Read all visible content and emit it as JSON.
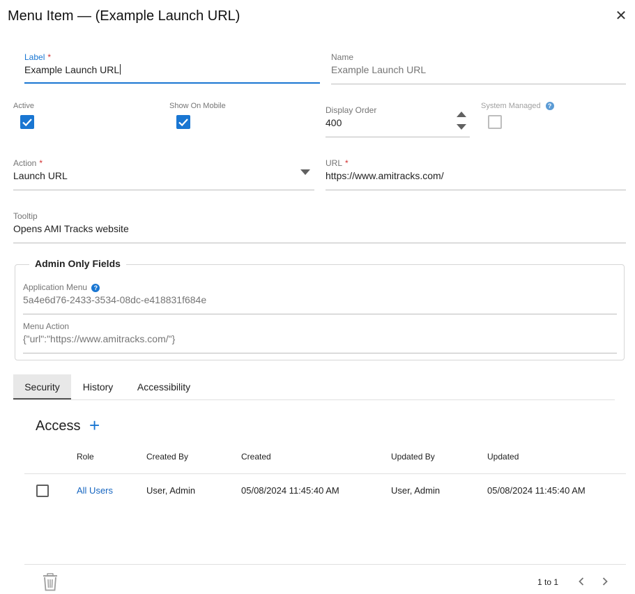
{
  "dialog": {
    "title": "Menu Item — (Example Launch URL)",
    "close_glyph": "✕"
  },
  "fields": {
    "label": {
      "label": "Label",
      "required": "*",
      "value": "Example Launch URL"
    },
    "name": {
      "label": "Name",
      "value": "Example Launch URL"
    },
    "active": {
      "label": "Active",
      "checked": true
    },
    "show_on_mobile": {
      "label": "Show On Mobile",
      "checked": true
    },
    "display_order": {
      "label": "Display Order",
      "value": "400"
    },
    "system_managed": {
      "label": "System Managed",
      "checked": false,
      "help_glyph": "?"
    },
    "action": {
      "label": "Action",
      "required": "*",
      "value": "Launch URL"
    },
    "url": {
      "label": "URL",
      "required": "*",
      "value": "https://www.amitracks.com/"
    },
    "tooltip": {
      "label": "Tooltip",
      "value": "Opens AMI Tracks website"
    }
  },
  "admin_fields": {
    "legend": "Admin Only Fields",
    "application_menu": {
      "label": "Application Menu",
      "value": "5a4e6d76-2433-3534-08dc-e418831f684e",
      "help_glyph": "?"
    },
    "menu_action": {
      "label": "Menu Action",
      "value": "{\"url\":\"https://www.amitracks.com/\"}"
    }
  },
  "tabs": [
    {
      "label": "Security",
      "active": true
    },
    {
      "label": "History",
      "active": false
    },
    {
      "label": "Accessibility",
      "active": false
    }
  ],
  "access": {
    "title": "Access",
    "add_glyph": "+",
    "columns": [
      "Role",
      "Created By",
      "Created",
      "Updated By",
      "Updated"
    ],
    "rows": [
      {
        "role": "All Users",
        "created_by": "User, Admin",
        "created": "05/08/2024 11:45:40 AM",
        "updated_by": "User, Admin",
        "updated": "05/08/2024 11:45:40 AM"
      }
    ],
    "pager": {
      "text": "1 to 1",
      "prev_glyph": "‹",
      "next_glyph": "›"
    }
  },
  "colors": {
    "accent": "#1976d2",
    "required": "#d32f2f",
    "link": "#1565c0"
  },
  "icons": {
    "close": "close-icon",
    "help": "help-circle-icon",
    "dropdown": "caret-down-icon",
    "stepper": "stepper-arrows-icon",
    "add": "plus-icon",
    "delete": "trash-icon",
    "prev": "chevron-left-icon",
    "next": "chevron-right-icon"
  }
}
